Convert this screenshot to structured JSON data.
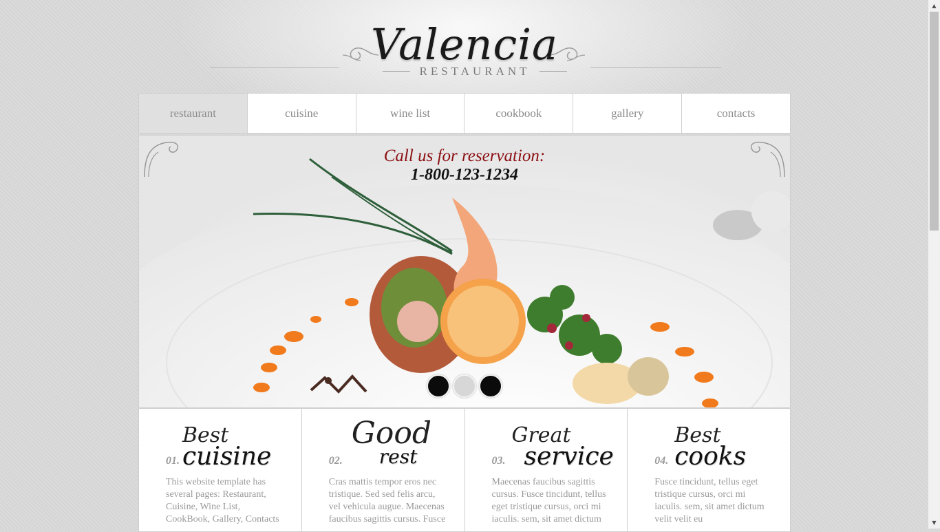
{
  "logo": {
    "title": "Valencia",
    "subtitle": "RESTAURANT"
  },
  "nav": {
    "items": [
      {
        "label": "restaurant"
      },
      {
        "label": "cuisine"
      },
      {
        "label": "wine list"
      },
      {
        "label": "cookbook"
      },
      {
        "label": "gallery"
      },
      {
        "label": "contacts"
      }
    ],
    "active": "restaurant"
  },
  "slider": {
    "reserve_text": "Call us for reservation:",
    "phone": "1-800-123-1234",
    "dots": 3,
    "active_dot": 2
  },
  "features": [
    {
      "num": "01.",
      "word1": "Best",
      "word2": "cuisine",
      "text": "This website template has several pages: Restaurant, Cuisine, Wine List, CookBook, Gallery, Contacts"
    },
    {
      "num": "02.",
      "word1": "Good",
      "word2": "rest",
      "text": "Cras mattis tempor eros nec tristique. Sed sed felis arcu, vel vehicula augue. Maecenas faucibus sagittis cursus. Fusce"
    },
    {
      "num": "03.",
      "word1": "Great",
      "word2": "service",
      "text": "Maecenas faucibus sagittis cursus. Fusce tincidunt, tellus eget tristique cursus, orci mi iaculis. sem, sit amet dictum"
    },
    {
      "num": "04.",
      "word1": "Best",
      "word2": "cooks",
      "text": "Fusce tincidunt, tellus eget tristique cursus, orci mi iaculis. sem, sit amet dictum velit velit eu"
    }
  ],
  "colors": {
    "accent": "#8b0f12",
    "nav_active_bg": "#e0e0e0"
  }
}
